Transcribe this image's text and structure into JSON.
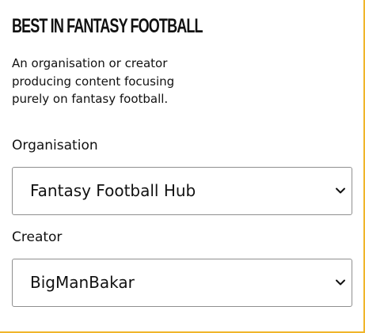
{
  "award": {
    "title": "Best in Fantasy Football",
    "description": "An organisation or creator producing content focusing purely on fantasy football.",
    "accent_color": "#f0b52a"
  },
  "fields": {
    "organisation": {
      "label": "Organisation",
      "selected": "Fantasy Football Hub",
      "icon": "chevron-down-icon"
    },
    "creator": {
      "label": "Creator",
      "selected": "BigManBakar",
      "icon": "chevron-down-icon"
    }
  }
}
